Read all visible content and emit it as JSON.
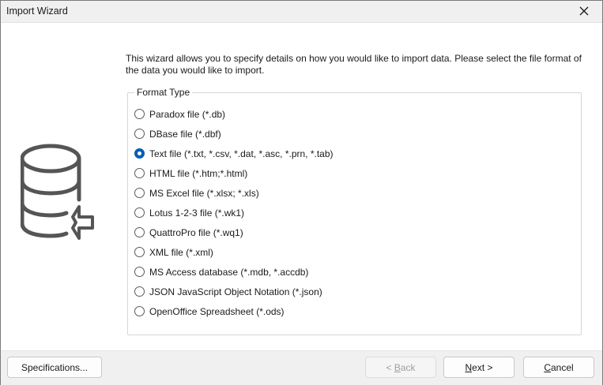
{
  "window": {
    "title": "Import Wizard"
  },
  "intro_text": "This wizard allows you to specify details on how you would like to import data. Please select the file format of the data you would like to import.",
  "format_type": {
    "legend": "Format Type",
    "selected_index": 2,
    "options": [
      {
        "label": "Paradox file (*.db)"
      },
      {
        "label": "DBase file (*.dbf)"
      },
      {
        "label": "Text file (*.txt, *.csv, *.dat, *.asc, *.prn, *.tab)"
      },
      {
        "label": "HTML file (*.htm;*.html)"
      },
      {
        "label": "MS Excel file (*.xlsx; *.xls)"
      },
      {
        "label": "Lotus 1-2-3 file (*.wk1)"
      },
      {
        "label": "QuattroPro file (*.wq1)"
      },
      {
        "label": "XML file (*.xml)"
      },
      {
        "label": "MS Access database (*.mdb, *.accdb)"
      },
      {
        "label": "JSON JavaScript Object Notation (*.json)"
      },
      {
        "label": "OpenOffice Spreadsheet (*.ods)"
      }
    ]
  },
  "buttons": {
    "specifications": "Specifications...",
    "back": {
      "prefix": "< ",
      "mnemonic": "B",
      "rest": "ack",
      "enabled": false
    },
    "next": {
      "mnemonic": "N",
      "rest": "ext >",
      "enabled": true
    },
    "cancel": {
      "mnemonic": "C",
      "rest": "ancel",
      "enabled": true
    }
  },
  "icons": {
    "close": "close-icon",
    "database_import": "database-import-icon"
  },
  "colors": {
    "accent": "#005fb8",
    "icon_stroke": "#555555",
    "footer_bg": "#f0f0f0"
  }
}
